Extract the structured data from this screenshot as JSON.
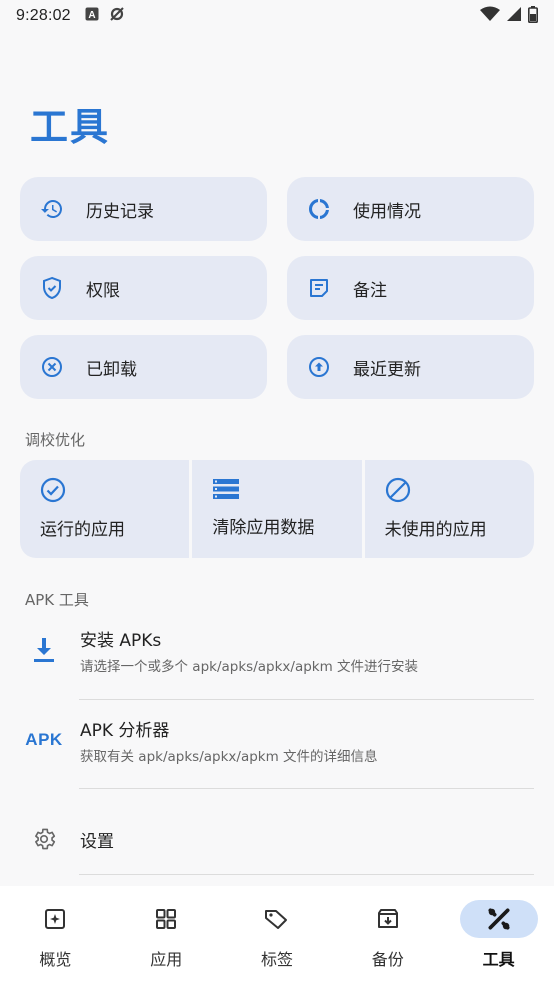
{
  "status_bar": {
    "time": "9:28:02"
  },
  "page": {
    "title": "工具"
  },
  "tools": [
    {
      "label": "历史记录",
      "icon": "history-icon"
    },
    {
      "label": "使用情况",
      "icon": "usage-donut-icon"
    },
    {
      "label": "权限",
      "icon": "shield-check-icon"
    },
    {
      "label": "备注",
      "icon": "note-icon"
    },
    {
      "label": "已卸载",
      "icon": "cancel-circle-icon"
    },
    {
      "label": "最近更新",
      "icon": "upgrade-circle-icon"
    }
  ],
  "tuning": {
    "section_label": "调校优化",
    "items": [
      {
        "label": "运行的应用",
        "icon": "check-circle-icon"
      },
      {
        "label": "清除应用数据",
        "icon": "storage-list-icon"
      },
      {
        "label": "未使用的应用",
        "icon": "block-icon"
      }
    ]
  },
  "apk_tools": {
    "section_label": "APK 工具",
    "install": {
      "title": "安装 APKs",
      "subtitle": "请选择一个或多个 apk/apks/apkx/apkm 文件进行安装"
    },
    "analyzer": {
      "badge": "APK",
      "title": "APK 分析器",
      "subtitle": "获取有关 apk/apks/apkx/apkm 文件的详细信息"
    },
    "settings": {
      "title": "设置"
    }
  },
  "bottom_nav": {
    "items": [
      {
        "label": "概览",
        "icon": "overview-icon"
      },
      {
        "label": "应用",
        "icon": "apps-grid-icon"
      },
      {
        "label": "标签",
        "icon": "tag-icon"
      },
      {
        "label": "备份",
        "icon": "backup-box-icon"
      },
      {
        "label": "工具",
        "icon": "tools-icon",
        "active": true
      }
    ]
  },
  "colors": {
    "accent": "#2a76d2",
    "tile_bg": "#e5e9f4",
    "active_pill": "#cfe0f8"
  }
}
